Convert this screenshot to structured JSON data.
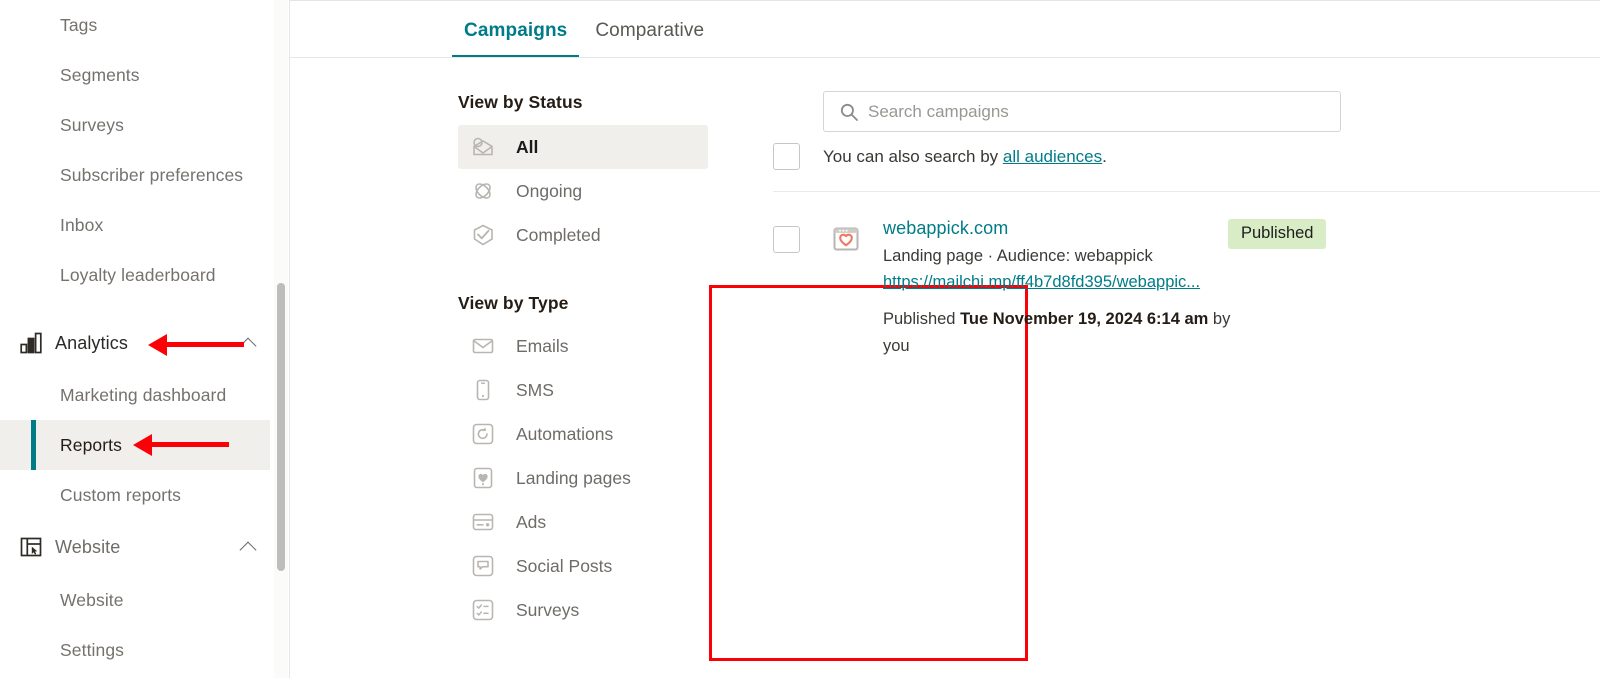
{
  "sidebar": {
    "items": [
      {
        "label": "Tags",
        "type": "sub",
        "icon": null,
        "name": "sidebar-item-tags"
      },
      {
        "label": "Segments",
        "type": "sub",
        "icon": null,
        "name": "sidebar-item-segments"
      },
      {
        "label": "Surveys",
        "type": "sub",
        "icon": null,
        "name": "sidebar-item-surveys"
      },
      {
        "label": "Subscriber preferences",
        "type": "sub",
        "icon": null,
        "name": "sidebar-item-subscriber-preferences"
      },
      {
        "label": "Inbox",
        "type": "sub",
        "icon": null,
        "name": "sidebar-item-inbox"
      },
      {
        "label": "Loyalty leaderboard",
        "type": "sub",
        "icon": null,
        "name": "sidebar-item-loyalty-leaderboard"
      },
      {
        "label": "Analytics",
        "type": "group",
        "icon": "bar-chart-icon",
        "name": "sidebar-item-analytics",
        "expanded": true
      },
      {
        "label": "Marketing dashboard",
        "type": "sub",
        "icon": null,
        "name": "sidebar-item-marketing-dashboard"
      },
      {
        "label": "Reports",
        "type": "sub",
        "icon": null,
        "name": "sidebar-item-reports",
        "active": true
      },
      {
        "label": "Custom reports",
        "type": "sub",
        "icon": null,
        "name": "sidebar-item-custom-reports"
      },
      {
        "label": "Website",
        "type": "group",
        "icon": "website-icon",
        "name": "sidebar-item-website",
        "expanded": true
      },
      {
        "label": "Website",
        "type": "sub",
        "icon": null,
        "name": "sidebar-item-website-sub"
      },
      {
        "label": "Settings",
        "type": "sub",
        "icon": null,
        "name": "sidebar-item-settings"
      }
    ]
  },
  "tabs": [
    {
      "label": "Campaigns",
      "active": true,
      "name": "tab-campaigns"
    },
    {
      "label": "Comparative",
      "active": false,
      "name": "tab-comparative"
    }
  ],
  "filters": {
    "status": {
      "title": "View by Status",
      "items": [
        {
          "label": "All",
          "icon": "all-campaigns-icon",
          "selected": true,
          "name": "filter-status-all"
        },
        {
          "label": "Ongoing",
          "icon": "ongoing-icon",
          "selected": false,
          "name": "filter-status-ongoing"
        },
        {
          "label": "Completed",
          "icon": "completed-icon",
          "selected": false,
          "name": "filter-status-completed"
        }
      ]
    },
    "type": {
      "title": "View by Type",
      "items": [
        {
          "label": "Emails",
          "icon": "envelope-icon",
          "name": "filter-type-emails"
        },
        {
          "label": "SMS",
          "icon": "phone-icon",
          "name": "filter-type-sms"
        },
        {
          "label": "Automations",
          "icon": "automation-icon",
          "name": "filter-type-automations"
        },
        {
          "label": "Landing pages",
          "icon": "landing-page-icon",
          "name": "filter-type-landing-pages"
        },
        {
          "label": "Ads",
          "icon": "ads-icon",
          "name": "filter-type-ads"
        },
        {
          "label": "Social Posts",
          "icon": "social-post-icon",
          "name": "filter-type-social-posts"
        },
        {
          "label": "Surveys",
          "icon": "survey-icon",
          "name": "filter-type-surveys"
        }
      ]
    }
  },
  "search": {
    "placeholder": "Search campaigns",
    "value": "",
    "icon": "search-icon",
    "search_by_prefix": "You can also search by ",
    "search_by_link": "all audiences",
    "search_by_suffix": "."
  },
  "campaign": {
    "title": "webappick.com",
    "icon": "landing-page-icon",
    "subtitle": "Landing page · Audience: webappick",
    "url": "https://mailchi.mp/ff4b7d8fd395/webappic...",
    "meta_prefix": "Published ",
    "meta_date": "Tue November 19, 2024 6:14 am",
    "meta_suffix": " by you",
    "status_badge": "Published"
  },
  "annotations": {
    "highlight_color": "#fb0007",
    "arrows": [
      {
        "target": "Analytics",
        "name": "annotation-arrow-analytics"
      },
      {
        "target": "Reports",
        "name": "annotation-arrow-reports"
      }
    ],
    "box": {
      "target": "View by Type",
      "name": "annotation-box-view-by-type"
    }
  },
  "colors": {
    "accent": "#007c89",
    "annotation": "#fb0007",
    "badge_bg": "#d8ecc6",
    "active_row_bg": "#f1efeb"
  }
}
